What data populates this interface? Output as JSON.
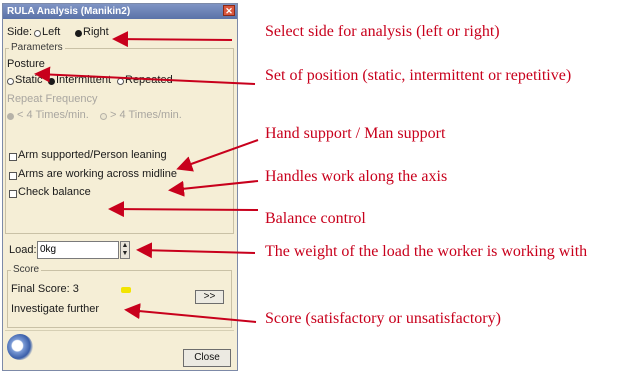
{
  "dialog": {
    "title": "RULA Analysis (Manikin2)",
    "close_glyph": "✕",
    "side_label": "Side:",
    "side_options": [
      "Left",
      "Right"
    ],
    "side_selected": "Right",
    "parameters_label": "Parameters",
    "posture_label": "Posture",
    "posture_options": [
      "Static",
      "Intermittent",
      "Repeated"
    ],
    "posture_selected": "Intermittent",
    "repeat_frequency_label": "Repeat Frequency",
    "repeat_options": [
      "< 4 Times/min.",
      "> 4 Times/min."
    ],
    "repeat_selected": "< 4 Times/min.",
    "checks": [
      {
        "label": "Arm supported/Person leaning",
        "checked": false
      },
      {
        "label": "Arms are working across midline",
        "checked": false
      },
      {
        "label": "Check balance",
        "checked": false
      }
    ],
    "load_label": "Load:",
    "load_value": "0kg",
    "score_label": "Score",
    "final_score": "Final Score: 3",
    "score_color": "#f2e400",
    "expand_button": ">>",
    "verdict": "Investigate further",
    "close_button": "Close"
  },
  "annotations": [
    "Select side for analysis (left or right)",
    "Set of position (static, intermittent or repetitive)",
    "Hand support / Man support",
    "Handles work along the axis",
    "Balance control",
    "The weight of the load the worker is working with",
    "Score (satisfactory or unsatisfactory)"
  ],
  "colors": {
    "annotation": "#c8001c",
    "dialog_bg": "#f5eed6",
    "title_bar": "#5a72a8"
  }
}
